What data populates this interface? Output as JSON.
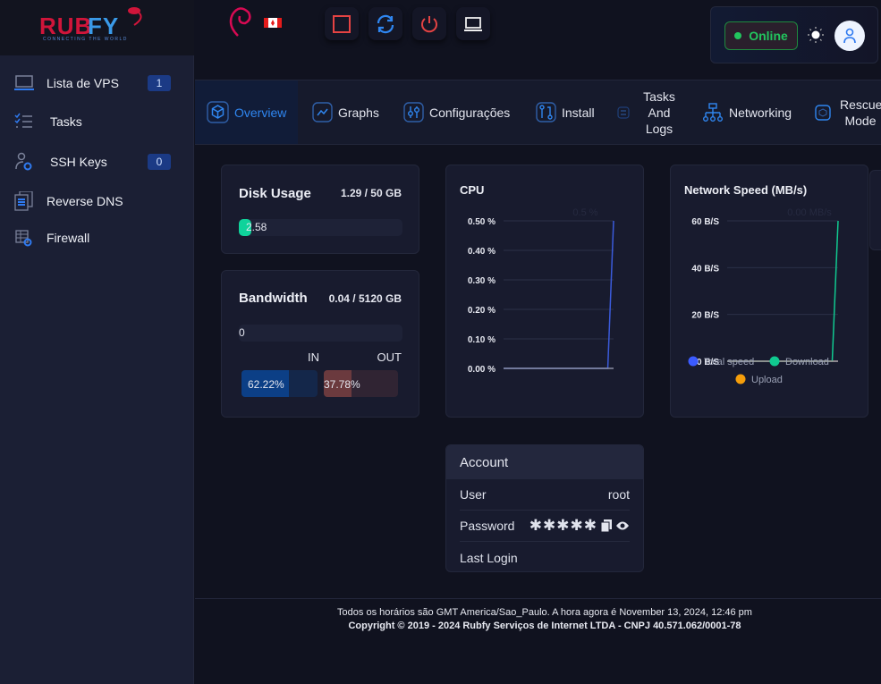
{
  "brand": {
    "logo_text": "RUBFY",
    "tagline": "CONNECTING THE WORLD"
  },
  "sidebar": {
    "items": [
      {
        "label": "Lista de VPS",
        "badge": "1",
        "icon": "laptop-icon"
      },
      {
        "label": "Tasks",
        "icon": "checklist-icon"
      },
      {
        "label": "SSH Keys",
        "badge": "0",
        "icon": "user-shield-icon"
      },
      {
        "label": "Reverse DNS",
        "icon": "server-stack-icon"
      },
      {
        "label": "Firewall",
        "icon": "firewall-icon"
      }
    ]
  },
  "topbar": {
    "os_icon": "debian-icon",
    "flag": "canada-flag",
    "buttons": [
      "stop-icon",
      "restart-icon",
      "power-icon",
      "console-icon"
    ],
    "status": "Online",
    "status_color": "#22c55e"
  },
  "tabs": [
    {
      "label": "Overview",
      "active": true
    },
    {
      "label": "Graphs"
    },
    {
      "label": "Configurações"
    },
    {
      "label": "Install"
    },
    {
      "label": "Tasks And Logs"
    },
    {
      "label": "Networking"
    },
    {
      "label": "Rescue Mode"
    }
  ],
  "disk": {
    "title": "Disk Usage",
    "value": "1.29 / 50 GB",
    "bar_label": "2.58",
    "percent": 2.58
  },
  "bandwidth": {
    "title": "Bandwidth",
    "value": "0.04 / 5120 GB",
    "bar_label": "0",
    "percent": 0,
    "in_label": "IN",
    "out_label": "OUT",
    "in_pct": "62.22%",
    "out_pct": "37.78%",
    "in_value": 62.22,
    "out_value": 37.78
  },
  "chart_data": [
    {
      "type": "line",
      "title": "CPU",
      "ghost_label": "0.5 %",
      "ylim": [
        0,
        0.5
      ],
      "yticks": [
        "0.50 %",
        "0.40 %",
        "0.30 %",
        "0.20 %",
        "0.10 %",
        "0.00 %"
      ],
      "grid": true,
      "series": [
        {
          "values": [
            0,
            0,
            0,
            0,
            0,
            0,
            0,
            0,
            0,
            0,
            0,
            0,
            0,
            0,
            0,
            0,
            0,
            0,
            0,
            0.5
          ],
          "color": "#3b5bdb"
        }
      ]
    },
    {
      "type": "line",
      "title": "Network Speed (MB/s)",
      "ghost_label": "0.00 MB/s",
      "ylim": [
        0,
        60
      ],
      "yticks": [
        "60 B/S",
        "40 B/S",
        "20 B/S",
        "0 B/S"
      ],
      "grid": true,
      "legend": "bottom",
      "series": [
        {
          "name": "Total speed",
          "color": "#3b5bff",
          "values": [
            0,
            0,
            0,
            0,
            0,
            0,
            0,
            0,
            0,
            0,
            0,
            0,
            0,
            0,
            0,
            0,
            0,
            0,
            0,
            0
          ]
        },
        {
          "name": "Download",
          "color": "#10c990",
          "values": [
            0,
            0,
            0,
            0,
            0,
            0,
            0,
            0,
            0,
            0,
            0,
            0,
            0,
            0,
            0,
            0,
            0,
            0,
            0,
            60
          ]
        },
        {
          "name": "Upload",
          "color": "#f59e0b",
          "values": [
            0,
            0,
            0,
            0,
            0,
            0,
            0,
            0,
            0,
            0,
            0,
            0,
            0,
            0,
            0,
            0,
            0,
            0,
            0,
            0
          ]
        }
      ]
    }
  ],
  "account": {
    "title": "Account",
    "rows": [
      {
        "label": "User",
        "value": "root"
      },
      {
        "label": "Password",
        "value": "✱✱✱✱✱"
      },
      {
        "label": "Last Login",
        "value": ""
      }
    ]
  },
  "footer": {
    "line1": "Todos os horários são GMT America/Sao_Paulo. A hora agora é November 13, 2024, 12:46 pm",
    "line2": "Copyright © 2019 - 2024 Rubfy Serviços de Internet LTDA - CNPJ 40.571.062/0001-78"
  }
}
